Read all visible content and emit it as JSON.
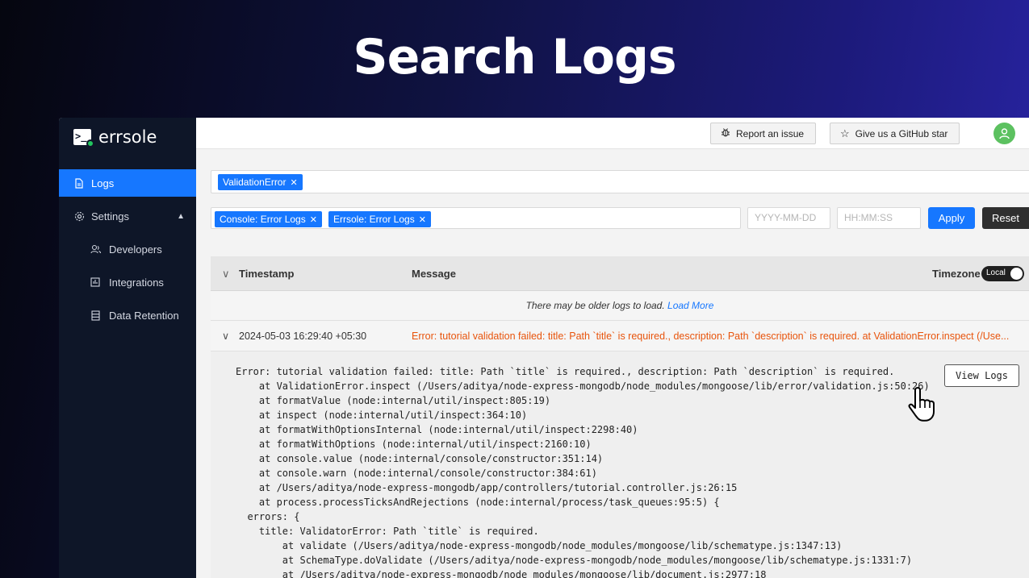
{
  "hero": {
    "title": "Search Logs"
  },
  "sidebar": {
    "brand": "errsole",
    "items": [
      {
        "label": "Logs",
        "icon": "file-text-icon",
        "active": true
      },
      {
        "label": "Settings",
        "icon": "gear-icon",
        "expanded": true
      },
      {
        "label": "Developers",
        "icon": "users-icon"
      },
      {
        "label": "Integrations",
        "icon": "chart-icon"
      },
      {
        "label": "Data Retention",
        "icon": "database-icon"
      }
    ]
  },
  "topbar": {
    "report_label": "Report an issue",
    "github_label": "Give us a GitHub star"
  },
  "search": {
    "tag": "ValidationError",
    "filters": [
      "Console: Error Logs",
      "Errsole: Error Logs"
    ],
    "date_placeholder": "YYYY-MM-DD",
    "time_placeholder": "HH:MM:SS",
    "apply_label": "Apply",
    "reset_label": "Reset"
  },
  "table": {
    "col_timestamp": "Timestamp",
    "col_message": "Message",
    "col_timezone": "Timezone",
    "timezone_value": "Local",
    "older_text": "There may be older logs to load.",
    "load_more": "Load More"
  },
  "log": {
    "timestamp": "2024-05-03 16:29:40 +05:30",
    "message": "Error: tutorial validation failed: title: Path `title` is required., description: Path `description` is required. at ValidationError.inspect (/Use...",
    "view_logs_label": "View Logs",
    "trace": [
      "Error: tutorial validation failed: title: Path `title` is required., description: Path `description` is required.",
      "    at ValidationError.inspect (/Users/aditya/node-express-mongodb/node_modules/mongoose/lib/error/validation.js:50:26)",
      "    at formatValue (node:internal/util/inspect:805:19)",
      "    at inspect (node:internal/util/inspect:364:10)",
      "    at formatWithOptionsInternal (node:internal/util/inspect:2298:40)",
      "    at formatWithOptions (node:internal/util/inspect:2160:10)",
      "    at console.value (node:internal/console/constructor:351:14)",
      "    at console.warn (node:internal/console/constructor:384:61)",
      "    at /Users/aditya/node-express-mongodb/app/controllers/tutorial.controller.js:26:15",
      "    at process.processTicksAndRejections (node:internal/process/task_queues:95:5) {",
      "  errors: {",
      "    title: ValidatorError: Path `title` is required.",
      "        at validate (/Users/aditya/node-express-mongodb/node_modules/mongoose/lib/schematype.js:1347:13)",
      "        at SchemaType.doValidate (/Users/aditya/node-express-mongodb/node_modules/mongoose/lib/schematype.js:1331:7)",
      "        at /Users/aditya/node-express-mongodb/node_modules/mongoose/lib/document.js:2977:18"
    ]
  },
  "colors": {
    "accent": "#1677ff",
    "error_text": "#e8540c",
    "sidebar_bg": "#0e1628",
    "avatar": "#5cc160"
  }
}
